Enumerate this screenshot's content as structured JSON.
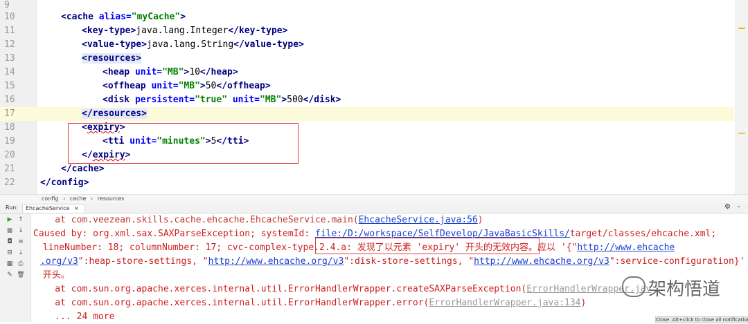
{
  "editor": {
    "lines": [
      {
        "num": "9"
      },
      {
        "num": "10"
      },
      {
        "num": "11"
      },
      {
        "num": "12"
      },
      {
        "num": "13"
      },
      {
        "num": "14"
      },
      {
        "num": "15"
      },
      {
        "num": "16"
      },
      {
        "num": "17"
      },
      {
        "num": "18"
      },
      {
        "num": "19"
      },
      {
        "num": "20"
      },
      {
        "num": "21"
      },
      {
        "num": "22"
      }
    ],
    "code": {
      "cache_open_tag": "<cache",
      "alias_attr": "alias=",
      "alias_val": "\"myCache\"",
      "gt": ">",
      "key_type_open": "<key-type>",
      "key_type_val": "java.lang.Integer",
      "key_type_close": "</key-type>",
      "value_type_open": "<value-type>",
      "value_type_val": "java.lang.String",
      "value_type_close": "</value-type>",
      "resources_open": "<resources>",
      "heap_tag": "<heap",
      "unit_attr": "unit=",
      "mb_val": "\"MB\"",
      "heap_val": "10",
      "heap_close": "</heap>",
      "offheap_tag": "<offheap",
      "offheap_val": "50",
      "offheap_close": "</offheap>",
      "disk_tag": "<disk",
      "persistent_attr": "persistent=",
      "true_val": "\"true\"",
      "disk_val": "500",
      "disk_close": "</disk>",
      "resources_close": "</resources>",
      "expiry_open_lt": "<",
      "expiry_word": "expiry",
      "tti_tag": "<tti",
      "minutes_val": "\"minutes\"",
      "tti_val": "5",
      "tti_close": "</tti>",
      "expiry_close_lt": "</",
      "cache_close": "</cache>",
      "config_close": "</config>"
    }
  },
  "breadcrumb": [
    "config",
    "cache",
    "resources"
  ],
  "run": {
    "label": "Run:",
    "tab": "EhcacheService"
  },
  "console": {
    "l1_prefix": "    at com.veezean.skills.cache.ehcache.EhcacheService.main(",
    "l1_link": "EhcacheService.java:56",
    "l1_suffix": ")",
    "l2_prefix": "Caused by: org.xml.sax.SAXParseException; systemId: ",
    "l2_link": "file:/D:/workspace/SelfDevelop/JavaBasicSkills/",
    "l2_suffix": "target/classes/ehcache.xml;",
    "l3_prefix": " lineNumber: 18; columnNumber: 17; cvc-complex-type.2.4.a: 发现了以元素 'expiry' 开头的无效内容。应以 '{\"",
    "l3_link": "http://www.ehcache",
    "l4_link1": ".org/v3",
    "l4_mid1": "\":heap-store-settings, \"",
    "l4_link2": "http://www.ehcache.org/v3",
    "l4_mid2": "\":disk-store-settings, \"",
    "l4_link3": "http://www.ehcache.org/v3",
    "l4_suffix": "\":service-configuration}' 之一",
    "l5": " 开头。",
    "l6_prefix": "    at com.sun.org.apache.xerces.internal.util.ErrorHandlerWrapper.createSAXParseException(",
    "l6_link": "ErrorHandlerWrapper.jav",
    "l7_prefix": "    at com.sun.org.apache.xerces.internal.util.ErrorHandlerWrapper.error(",
    "l7_link": "ErrorHandlerWrapper.java:134",
    "l7_suffix": ")",
    "l8": "    ... 24 more"
  },
  "watermark": "架构悟道",
  "notification": "Close. Alt+click to close all notifications"
}
